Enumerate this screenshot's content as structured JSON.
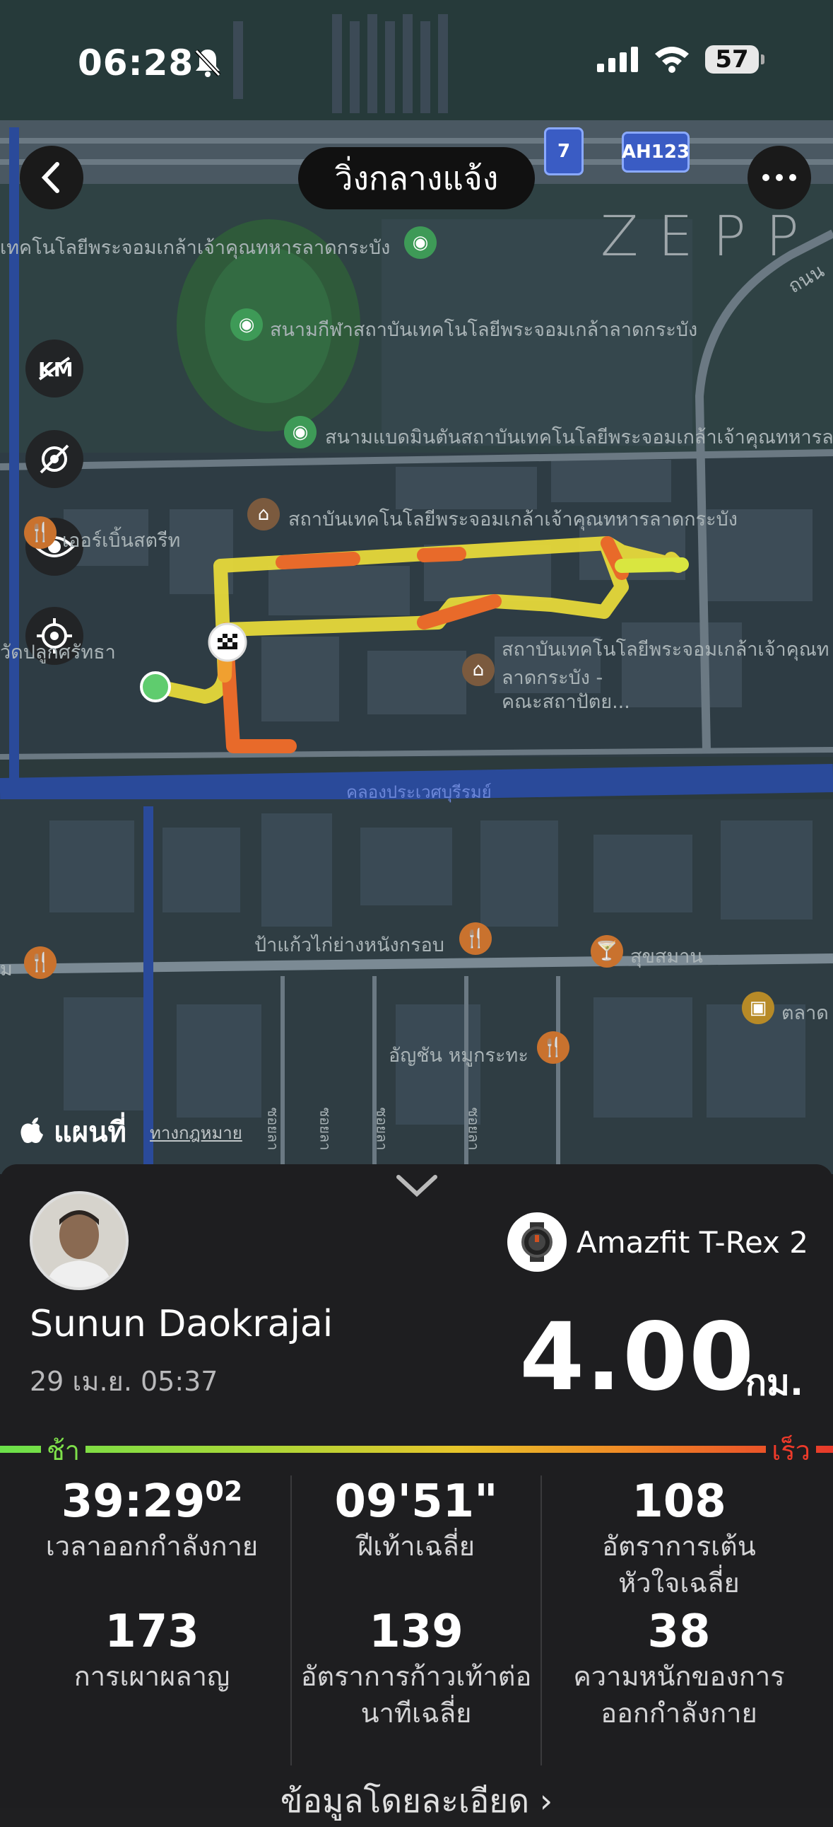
{
  "status_bar": {
    "time": "06:28",
    "battery": "57"
  },
  "header": {
    "title": "วิ่งกลางแจ้ง"
  },
  "watermark": "ZEPP",
  "map": {
    "labels": {
      "inst_top": "เทคโนโลยีพระจอมเกล้าเจ้าคุณทหารลาดกระบัง",
      "stadium": "สนามกีฬาสถาบันเทคโนโลยีพระจอมเกล้าลาดกระบัง",
      "badminton": "สนามแบดมินตันสถาบันเทคโนโลยีพระจอมเกล้าเจ้าคุณทหารลาด",
      "institute": "สถาบันเทคโนโลยีพระจอมเกล้าเจ้าคุณทหารลาดกระบัง",
      "street": "เออร์เบิ้นสตรีท",
      "temple": "วัดปลูกศรัทธา",
      "faculty_1": "สถาบันเทคโนโลยีพระจอมเกล้าเจ้าคุณท",
      "faculty_2": "ลาดกระบัง -",
      "faculty_3": "คณะสถาปัตย...",
      "canal": "คลองประเวศบุรีรมย์",
      "restaurant_1": "ป้าแก้วไก่ย่างหนังกรอบ",
      "bar": "สุขสมาน",
      "market": "ตลาด",
      "restaurant_2": "อัญชัน หมูกระทะ",
      "road_right": "ถนน",
      "lm": "ม",
      "soi_1": "ซอยลา",
      "soi_2": "ซอยลา",
      "soi_3": "ซอยลา",
      "soi_4": "ซอยลา"
    },
    "shields": {
      "route7": "7",
      "ah": "AH123"
    },
    "attribution": "แผนที่",
    "legal": "ทางกฎหมาย"
  },
  "summary": {
    "device_name": "Amazfit T-Rex 2",
    "user_name": "Sunun Daokrajai",
    "date": "29 เม.ย. 05:37",
    "distance": "4.00",
    "distance_unit": "กม.",
    "pace_slow": "ช้า",
    "pace_fast": "เร็ว",
    "stats": {
      "duration_main": "39:29",
      "duration_sub": "02",
      "duration_label": "เวลาออกกำลังกาย",
      "pace_value": "09'51\"",
      "pace_label": "ฝีเท้าเฉลี่ย",
      "hr_value": "108",
      "hr_label_1": "อัตราการเต้น",
      "hr_label_2": "หัวใจเฉลี่ย",
      "cal_value": "173",
      "cal_label": "การเผาผลาญ",
      "cadence_value": "139",
      "cadence_label_1": "อัตราการก้าวเท้าต่อ",
      "cadence_label_2": "นาทีเฉลี่ย",
      "load_value": "38",
      "load_label_1": "ความหนักของการ",
      "load_label_2": "ออกกำลังกาย"
    },
    "more_details": "ข้อมูลโดยละเอียด ›"
  },
  "colors": {
    "panel_bg": "#1e1e20",
    "slow": "#7ee04a",
    "fast": "#ee3a2a"
  }
}
